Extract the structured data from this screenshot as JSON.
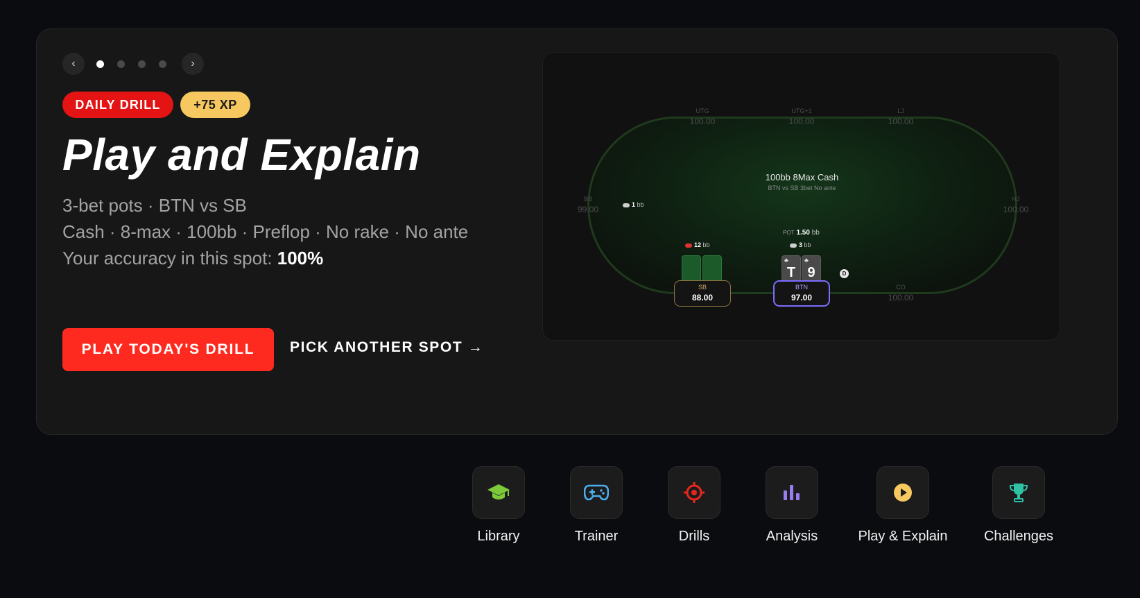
{
  "carousel": {
    "dots": 4,
    "active_index": 0
  },
  "hero": {
    "badge_daily": "DAILY DRILL",
    "badge_xp": "+75 XP",
    "title": "Play and Explain",
    "line1": "3-bet pots · BTN vs SB",
    "line2": "Cash · 8-max · 100bb · Preflop · No rake · No ante",
    "accuracy_prefix": "Your accuracy in this spot: ",
    "accuracy_value": "100%",
    "primary_cta": "PLAY TODAY'S DRILL",
    "secondary_cta": "PICK ANOTHER SPOT →"
  },
  "table": {
    "title": "100bb 8Max Cash",
    "subtitle": "BTN vs SB 3bet No ante",
    "seats": {
      "utg": {
        "pos": "UTG",
        "stack": "100.00"
      },
      "utg1": {
        "pos": "UTG+1",
        "stack": "100.00"
      },
      "lj": {
        "pos": "LJ",
        "stack": "100.00"
      },
      "hj": {
        "pos": "HJ",
        "stack": "100.00"
      },
      "co": {
        "pos": "CO",
        "stack": "100.00"
      },
      "bb": {
        "pos": "BB",
        "stack": "99.00"
      },
      "sb": {
        "pos": "SB",
        "stack": "88.00"
      },
      "btn": {
        "pos": "BTN",
        "stack": "97.00"
      }
    },
    "bets": {
      "bb": {
        "amount": "1",
        "unit": "bb"
      },
      "sb": {
        "amount": "12",
        "unit": "bb"
      },
      "btn": {
        "amount": "3",
        "unit": "bb"
      }
    },
    "pot": {
      "label": "POT",
      "amount": "1.50",
      "unit": "bb"
    },
    "hero_cards": [
      {
        "rank": "T",
        "suit": "♣"
      },
      {
        "rank": "9",
        "suit": "♣"
      }
    ],
    "dealer_button": "D"
  },
  "nav": [
    {
      "label": "Library",
      "icon": "graduation-cap-icon",
      "color": "#7dc93a"
    },
    {
      "label": "Trainer",
      "icon": "gamepad-icon",
      "color": "#4ab0f0"
    },
    {
      "label": "Drills",
      "icon": "target-icon",
      "color": "#e8261c"
    },
    {
      "label": "Analysis",
      "icon": "bar-chart-icon",
      "color": "#9b7bf0"
    },
    {
      "label": "Play & Explain",
      "icon": "play-circle-icon",
      "color": "#f6c85f"
    },
    {
      "label": "Challenges",
      "icon": "trophy-icon",
      "color": "#2fc2a5"
    }
  ]
}
